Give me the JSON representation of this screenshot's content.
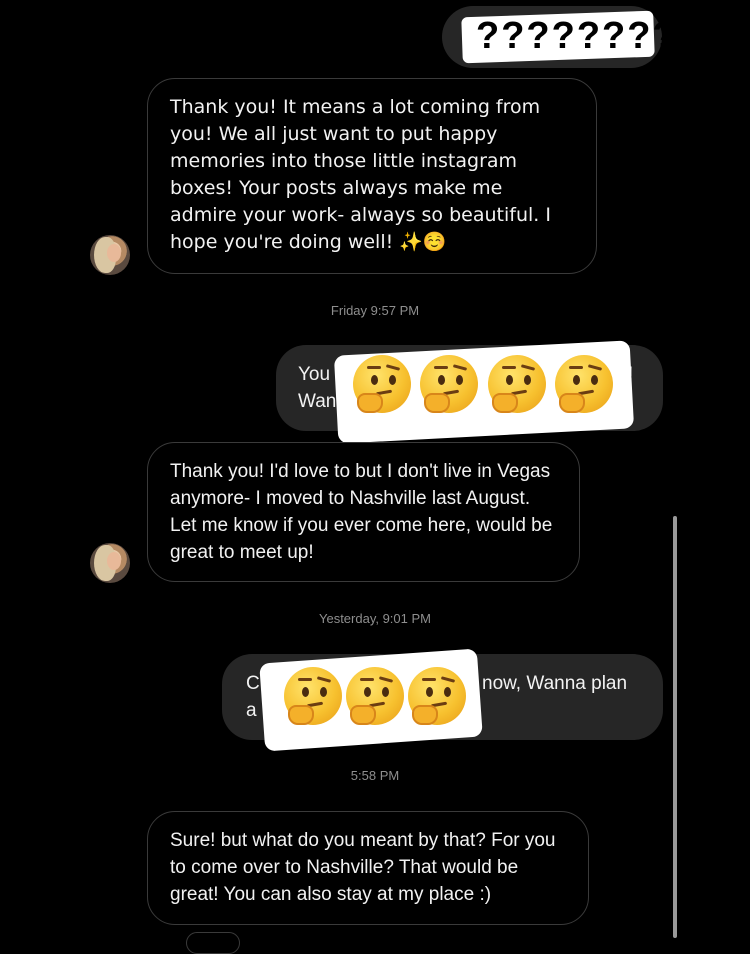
{
  "messages": {
    "top_sent": "????????",
    "received_1": "Thank you! It means a lot coming from you! We all just want to put happy memories into those little instagram boxes! Your posts always make me admire your work- always so beautiful. I hope you're doing well! ✨☺️",
    "stamp_1": "Friday 9:57 PM",
    "sent_1_line1": "You",
    "sent_1_line2": "Wan",
    "sent_1_end": "!",
    "received_2": "Thank you! I'd love to but I don't live in Vegas anymore- I moved to Nashville last August. Let me know if you ever come here, would be great to meet up!",
    "stamp_2": "Yesterday, 9:01 PM",
    "sent_2_line1_start": "C",
    "sent_2_line1_end": "now, Wanna plan",
    "sent_2_line2_start": "a",
    "stamp_3": "5:58 PM",
    "received_3": "Sure! but what do you meant by that? For you to come over to Nashville? That would be great! You can also stay at my place :)"
  },
  "icons": {
    "censor_emoji": "thinking-face",
    "avatar": "contact-avatar"
  }
}
